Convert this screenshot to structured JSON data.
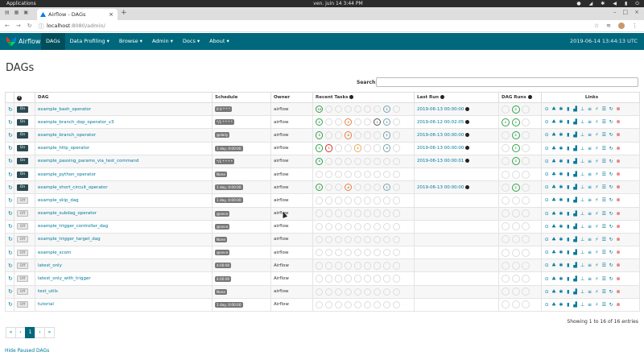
{
  "system": {
    "apps_label": "Applications",
    "clock": "ven. juin 14   3:44 PM"
  },
  "browser": {
    "tab_title": "Airflow - DAGs",
    "new_tab_symbol": "+",
    "url_host": "localhost",
    "url_rest": ":8080/admin/"
  },
  "nav": {
    "brand": "Airflow",
    "items": [
      {
        "label": "DAGs"
      },
      {
        "label": "Data Profiling ▾"
      },
      {
        "label": "Browse ▾"
      },
      {
        "label": "Admin ▾"
      },
      {
        "label": "Docs ▾"
      },
      {
        "label": "About ▾"
      }
    ],
    "timestamp": "2019-06-14 13:44:13 UTC"
  },
  "page": {
    "title": "DAGs",
    "search_label": "Search:"
  },
  "table": {
    "headers": {
      "info": "i",
      "dag": "DAG",
      "schedule": "Schedule",
      "owner": "Owner",
      "recent_tasks": "Recent Tasks",
      "last_run": "Last Run",
      "dag_runs": "DAG Runs",
      "links": "Links"
    },
    "rows": [
      {
        "on": "On",
        "dag": "example_bash_operator",
        "schedule": "0 0 * * *",
        "owner": "airflow",
        "tasks": [
          {
            "t": "10",
            "c": "#28a745"
          },
          {},
          {},
          {},
          {},
          {},
          {},
          {
            "t": "1",
            "c": "#6fa6b8"
          },
          {}
        ],
        "last_run": "2019-06-13 00:00:00",
        "runs": [
          {},
          {
            "t": "2",
            "c": "#28a745"
          },
          {}
        ]
      },
      {
        "on": "On",
        "dag": "example_branch_dop_operator_v3",
        "schedule": "*/1 * * * *",
        "owner": "airflow",
        "tasks": [
          {
            "t": "4",
            "c": "#28a745"
          },
          {},
          {},
          {
            "t": "2",
            "c": "#f27c38"
          },
          {},
          {},
          {
            "t": "1",
            "c": "#555"
          },
          {
            "t": "1",
            "c": "#6fa6b8"
          },
          {}
        ],
        "last_run": "2019-06-12 00:02:05",
        "runs": [
          {
            "t": "2",
            "c": "#28a745"
          },
          {
            "t": "2",
            "c": "#28a745"
          },
          {}
        ]
      },
      {
        "on": "On",
        "dag": "example_branch_operator",
        "schedule": "@daily",
        "owner": "airflow",
        "tasks": [
          {
            "t": "5",
            "c": "#28a745"
          },
          {},
          {},
          {
            "t": "4",
            "c": "#f27c38"
          },
          {},
          {},
          {},
          {
            "t": "1",
            "c": "#6fa6b8"
          },
          {}
        ],
        "last_run": "2019-06-13 00:00:00",
        "runs": [
          {},
          {
            "t": "2",
            "c": "#28a745"
          },
          {}
        ]
      },
      {
        "on": "On",
        "dag": "example_http_operator",
        "schedule": "1 day, 0:00:00",
        "owner": "airflow",
        "tasks": [
          {
            "t": "2",
            "c": "#28a745"
          },
          {
            "t": "1",
            "c": "#d9302c"
          },
          {},
          {},
          {
            "t": "1",
            "c": "#f0ad4e"
          },
          {},
          {},
          {
            "t": "4",
            "c": "#6fa6b8"
          },
          {}
        ],
        "last_run": "2019-06-13 00:00:00",
        "runs": [
          {},
          {
            "t": "2",
            "c": "#28a745"
          },
          {}
        ]
      },
      {
        "on": "On",
        "dag": "example_passing_params_via_test_command",
        "schedule": "*/1 * * * *",
        "owner": "airflow",
        "tasks": [
          {
            "t": "4",
            "c": "#28a745"
          },
          {},
          {},
          {},
          {},
          {},
          {},
          {},
          {}
        ],
        "last_run": "2019-06-13 00:00:01",
        "runs": [
          {},
          {
            "t": "2",
            "c": "#28a745"
          },
          {}
        ]
      },
      {
        "on": "On",
        "dag": "example_python_operator",
        "schedule": "None",
        "owner": "airflow",
        "tasks": [
          {},
          {},
          {},
          {},
          {},
          {},
          {},
          {},
          {}
        ],
        "last_run": "",
        "runs": [
          {},
          {},
          {}
        ]
      },
      {
        "on": "On",
        "dag": "example_short_circuit_operator",
        "schedule": "1 day, 0:00:00",
        "owner": "airflow",
        "tasks": [
          {
            "t": "2",
            "c": "#28a745"
          },
          {},
          {},
          {
            "t": "4",
            "c": "#f27c38"
          },
          {},
          {},
          {},
          {
            "t": "1",
            "c": "#6fa6b8"
          },
          {}
        ],
        "last_run": "2019-06-13 00:00:00",
        "runs": [
          {},
          {
            "t": "2",
            "c": "#28a745"
          },
          {}
        ]
      },
      {
        "on": "Off",
        "dag": "example_skip_dag",
        "schedule": "1 day, 0:00:00",
        "owner": "airflow",
        "tasks": [
          {},
          {},
          {},
          {},
          {},
          {},
          {},
          {},
          {}
        ],
        "last_run": "",
        "runs": [
          {},
          {},
          {}
        ]
      },
      {
        "on": "Off",
        "dag": "example_subdag_operator",
        "schedule": "@once",
        "owner": "airflow",
        "tasks": [
          {},
          {},
          {},
          {},
          {},
          {},
          {},
          {},
          {}
        ],
        "last_run": "",
        "runs": [
          {},
          {},
          {}
        ]
      },
      {
        "on": "Off",
        "dag": "example_trigger_controller_dag",
        "schedule": "@once",
        "owner": "airflow",
        "tasks": [
          {},
          {},
          {},
          {},
          {},
          {},
          {},
          {},
          {}
        ],
        "last_run": "",
        "runs": [
          {},
          {},
          {}
        ]
      },
      {
        "on": "Off",
        "dag": "example_trigger_target_dag",
        "schedule": "None",
        "owner": "airflow",
        "tasks": [
          {},
          {},
          {},
          {},
          {},
          {},
          {},
          {},
          {}
        ],
        "last_run": "",
        "runs": [
          {},
          {},
          {}
        ]
      },
      {
        "on": "Off",
        "dag": "example_xcom",
        "schedule": "@once",
        "owner": "airflow",
        "tasks": [
          {},
          {},
          {},
          {},
          {},
          {},
          {},
          {},
          {}
        ],
        "last_run": "",
        "runs": [
          {},
          {},
          {}
        ]
      },
      {
        "on": "Off",
        "dag": "latest_only",
        "schedule": "4:00:00",
        "owner": "Airflow",
        "tasks": [
          {},
          {},
          {},
          {},
          {},
          {},
          {},
          {},
          {}
        ],
        "last_run": "",
        "runs": [
          {},
          {},
          {}
        ]
      },
      {
        "on": "Off",
        "dag": "latest_only_with_trigger",
        "schedule": "4:00:00",
        "owner": "Airflow",
        "tasks": [
          {},
          {},
          {},
          {},
          {},
          {},
          {},
          {},
          {}
        ],
        "last_run": "",
        "runs": [
          {},
          {},
          {}
        ]
      },
      {
        "on": "Off",
        "dag": "test_utils",
        "schedule": "None",
        "owner": "airflow",
        "tasks": [
          {},
          {},
          {},
          {},
          {},
          {},
          {},
          {},
          {}
        ],
        "last_run": "",
        "runs": [
          {},
          {},
          {}
        ]
      },
      {
        "on": "Off",
        "dag": "tutorial",
        "schedule": "1 day, 0:00:00",
        "owner": "Airflow",
        "tasks": [
          {},
          {},
          {},
          {},
          {},
          {},
          {},
          {},
          {}
        ],
        "last_run": "",
        "runs": [
          {},
          {},
          {}
        ]
      }
    ],
    "link_icons": [
      "trigger-dag-icon",
      "tree-view-icon",
      "graph-view-icon",
      "duration-icon",
      "task-tries-icon",
      "landing-times-icon",
      "gantt-icon",
      "code-icon",
      "logs-icon",
      "refresh-icon",
      "delete-icon"
    ],
    "link_glyphs": [
      "⊙",
      "♣",
      "✱",
      "▮",
      "▟",
      "⊥",
      "≡",
      "⚡",
      "☰",
      "↻",
      "⊗"
    ]
  },
  "footer": {
    "entries_text": "Showing 1 to 16 of 16 entries",
    "pager": [
      "«",
      "‹",
      "1",
      "›",
      "»"
    ],
    "hide_paused": "Hide Paused DAGs"
  },
  "colors": {
    "navbar": "#00687d",
    "link": "#00799c",
    "success": "#28a745",
    "failed": "#d9302c"
  }
}
